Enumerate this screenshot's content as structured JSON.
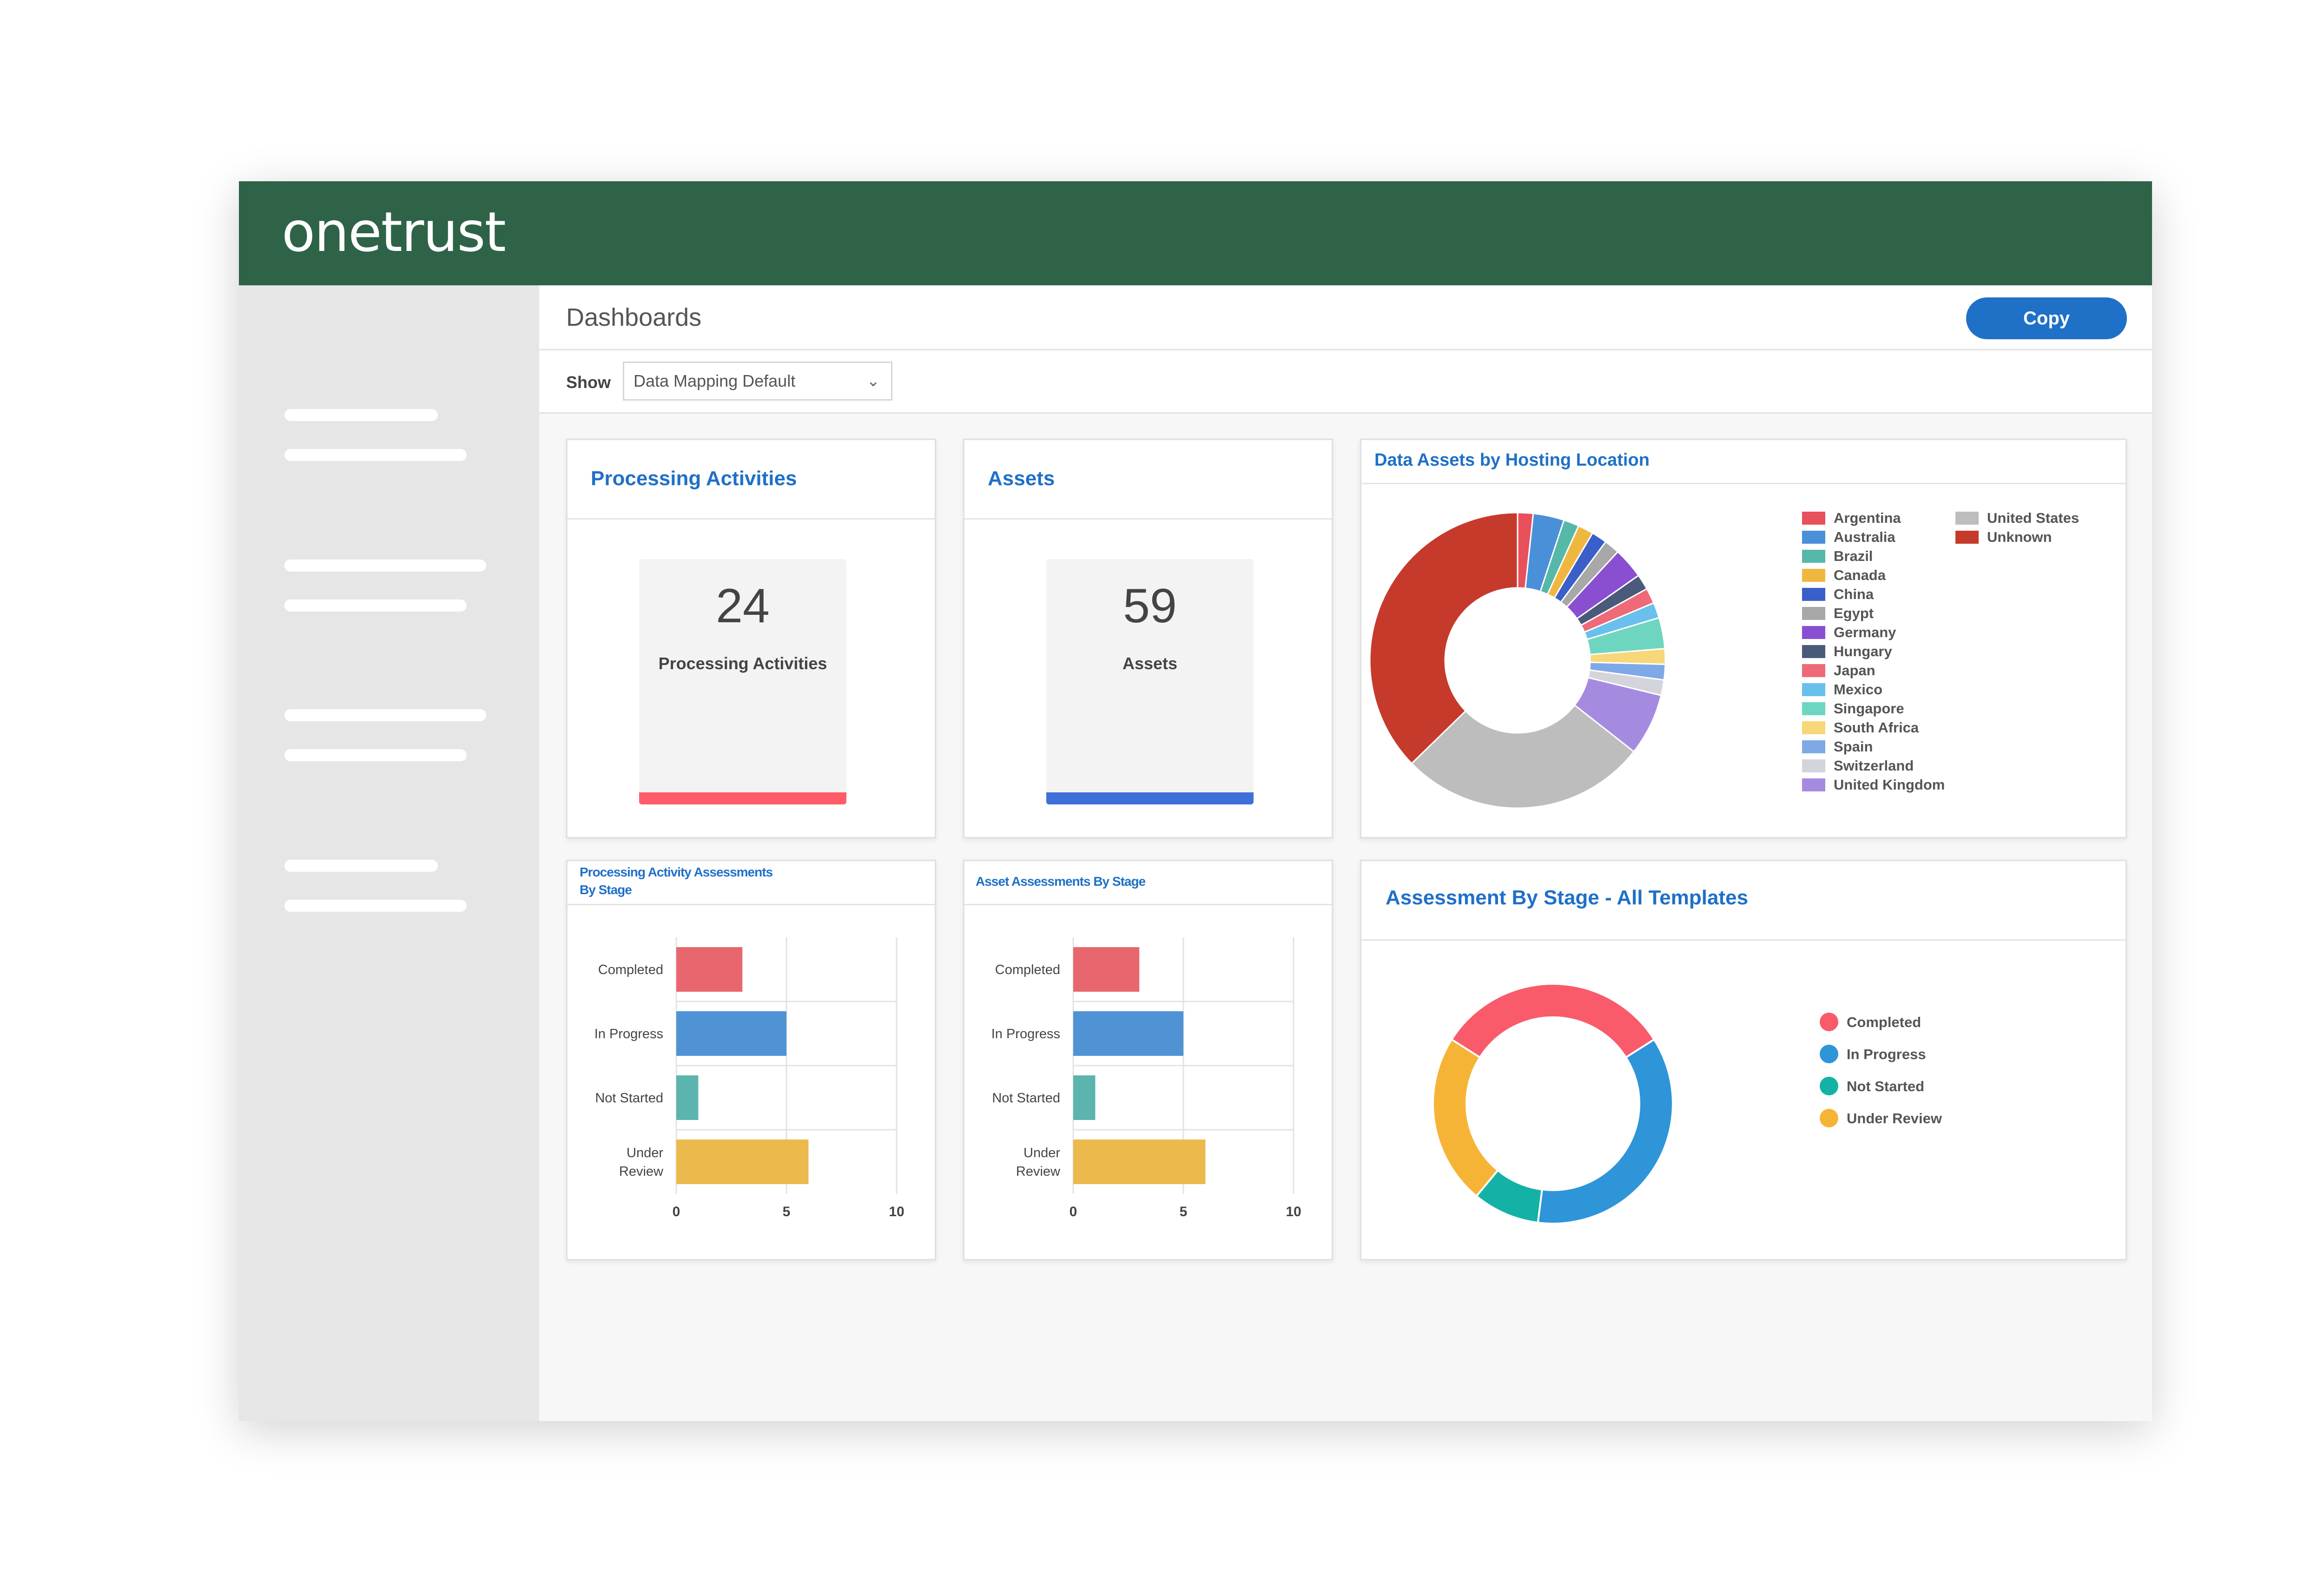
{
  "app": {
    "logo": "onetrust"
  },
  "header": {
    "title": "Dashboards",
    "copy_label": "Copy"
  },
  "filter": {
    "show_label": "Show",
    "selected": "Data Mapping Default"
  },
  "colors": {
    "brand_green": "#2e6348",
    "accent_blue": "#1f70c7",
    "red": "#ff5c6a",
    "blue": "#3f6fd9"
  },
  "cards": {
    "processing": {
      "title": "Processing Activities",
      "value": "24",
      "label": "Processing Activities"
    },
    "assets": {
      "title": "Assets",
      "value": "59",
      "label": "Assets"
    },
    "hosting": {
      "title": "Data Assets by Hosting Location"
    },
    "pa_assess": {
      "title_line1": "Processing Activity Assessments",
      "title_line2": "By Stage"
    },
    "asset_assess": {
      "title": "Asset Assessments By Stage"
    },
    "all_templates": {
      "title": "Assessment By Stage - All Templates"
    }
  },
  "chart_data": [
    {
      "type": "pie",
      "title": "Data Assets by Hosting Location",
      "categories": [
        "Argentina",
        "Australia",
        "Brazil",
        "Canada",
        "China",
        "Egypt",
        "Germany",
        "Hungary",
        "Japan",
        "Mexico",
        "Singapore",
        "South Africa",
        "Spain",
        "Switzerland",
        "United Kingdom",
        "United States",
        "Unknown"
      ],
      "values": [
        1,
        2,
        1,
        1,
        1,
        1,
        2,
        1,
        1,
        1,
        2,
        1,
        1,
        1,
        4,
        16,
        22
      ],
      "colors": [
        "#e8505b",
        "#4a90d9",
        "#55b8a8",
        "#f0b740",
        "#3a5fc8",
        "#a8a8a8",
        "#8a4fd1",
        "#4a5a7a",
        "#ee6a78",
        "#6ac0ec",
        "#6ed6c0",
        "#f7d77a",
        "#7fa9e6",
        "#d4d4dc",
        "#a58be0",
        "#bdbdbd",
        "#c63a2c"
      ],
      "legend": "right"
    },
    {
      "type": "bar",
      "title": "Processing Activity Assessments By Stage",
      "categories": [
        "Completed",
        "In Progress",
        "Not Started",
        "Under Review"
      ],
      "values": [
        3,
        5,
        1,
        6
      ],
      "colors": [
        "#e8676e",
        "#5093d4",
        "#5cb4ae",
        "#ebb94c"
      ],
      "xlim": [
        0,
        10
      ],
      "xticks": [
        "0",
        "5",
        "10"
      ]
    },
    {
      "type": "bar",
      "title": "Asset Assessments By Stage",
      "categories": [
        "Completed",
        "In Progress",
        "Not Started",
        "Under Review"
      ],
      "values": [
        3,
        5,
        1,
        6
      ],
      "colors": [
        "#e8676e",
        "#5093d4",
        "#5cb4ae",
        "#ebb94c"
      ],
      "xlim": [
        0,
        10
      ],
      "xticks": [
        "0",
        "5",
        "10"
      ]
    },
    {
      "type": "pie",
      "title": "Assessment By Stage - All Templates",
      "categories": [
        "Completed",
        "In Progress",
        "Not Started",
        "Under Review"
      ],
      "values": [
        32,
        36,
        9,
        23
      ],
      "colors": [
        "#f95b6b",
        "#2e95d9",
        "#14b2a6",
        "#f6b436"
      ],
      "legend": "right"
    }
  ]
}
